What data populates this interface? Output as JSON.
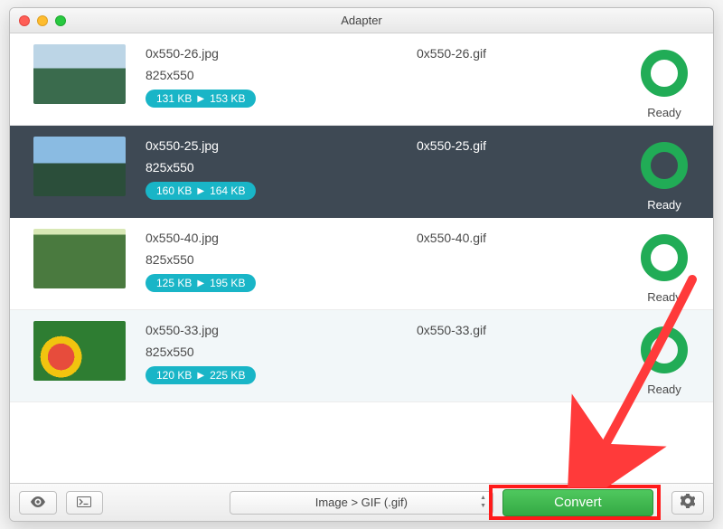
{
  "window": {
    "title": "Adapter"
  },
  "rows": [
    {
      "src": "0x550-26.jpg",
      "dst": "0x550-26.gif",
      "dims": "825x550",
      "size_in": "131 KB",
      "size_out": "153 KB",
      "status": "Ready"
    },
    {
      "src": "0x550-25.jpg",
      "dst": "0x550-25.gif",
      "dims": "825x550",
      "size_in": "160 KB",
      "size_out": "164 KB",
      "status": "Ready"
    },
    {
      "src": "0x550-40.jpg",
      "dst": "0x550-40.gif",
      "dims": "825x550",
      "size_in": "125 KB",
      "size_out": "195 KB",
      "status": "Ready"
    },
    {
      "src": "0x550-33.jpg",
      "dst": "0x550-33.gif",
      "dims": "825x550",
      "size_in": "120 KB",
      "size_out": "225 KB",
      "status": "Ready"
    }
  ],
  "footer": {
    "format_label": "Image > GIF (.gif)",
    "convert_label": "Convert"
  },
  "colors": {
    "pill": "#19b5c7",
    "ring": "#21ac56",
    "convert": "#3db94d",
    "selected_row": "#3e4954",
    "annotation": "#ff1a1a"
  }
}
